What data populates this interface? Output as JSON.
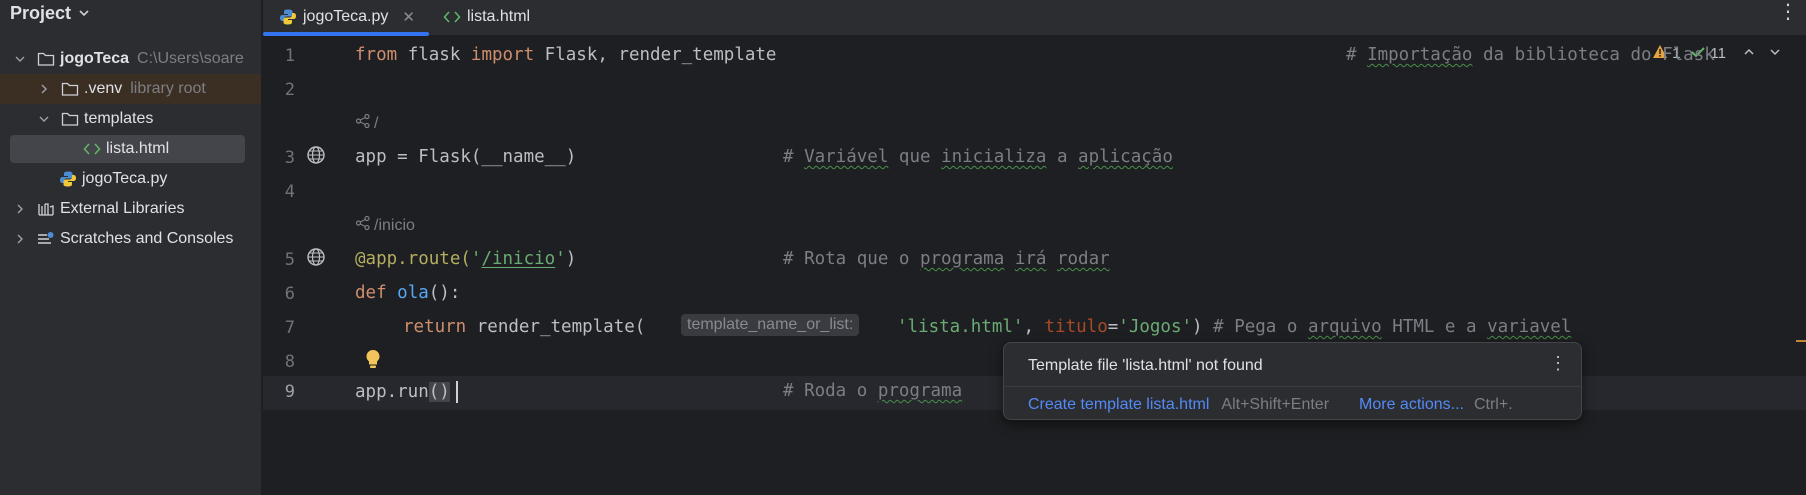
{
  "project_panel": {
    "title": "Project",
    "tree": [
      {
        "label": "jogoTeca",
        "hint": "C:\\Users\\soare"
      },
      {
        "label": ".venv",
        "hint": "library root"
      },
      {
        "label": "templates"
      },
      {
        "label": "lista.html"
      },
      {
        "label": "jogoTeca.py"
      },
      {
        "label": "External Libraries"
      },
      {
        "label": "Scratches and Consoles"
      }
    ]
  },
  "tabs": [
    {
      "label": "jogoTeca.py",
      "active": true
    },
    {
      "label": "lista.html",
      "active": false
    }
  ],
  "inspection": {
    "warnings": "1",
    "ok": "11"
  },
  "editor": {
    "line_numbers": [
      "1",
      "2",
      "3",
      "4",
      "5",
      "6",
      "7",
      "8",
      "9"
    ],
    "line1": {
      "kw1": "from",
      "mod": " flask ",
      "kw2": "import",
      "names": " Flask, render_template",
      "comment_pre": "# ",
      "comment_w1": "Importação",
      " comment_rest": "",
      "comment_rest": " da biblioteca do Flask"
    },
    "route1": "/",
    "line3": {
      "code": "app = Flask(__name__)",
      "cm_a": "# ",
      "cm_w1": "Variável",
      "cm_b": " que ",
      "cm_w2": "inicializa",
      "cm_c": " a ",
      "cm_w3": "aplicação"
    },
    "route2": "/inicio",
    "line5": {
      "dec": "@app.route(",
      "str_q": "'",
      "str_path": "/inicio",
      "str_q2": "'",
      "close": ")",
      "cm_a": "# Rota que o ",
      "cm_w1": "programa",
      "cm_b": " ",
      "cm_w2": "irá",
      "cm_c": " ",
      "cm_w3": "rodar"
    },
    "line6": {
      "kw": "def",
      "fn": "ola",
      "rest": "():"
    },
    "line7": {
      "kw": "return",
      "call": " render_template(",
      "hint": "template_name_or_list:",
      "str1": "'lista.html'",
      "comma": ", ",
      "param": "titulo",
      "eq": "=",
      "str2": "'Jogos'",
      "close": ")",
      "cm_a": " # Pega o ",
      "cm_w1": "arquivo",
      "cm_b": " HTML e a ",
      "cm_w2": "variavel"
    },
    "line9": {
      "code": "app.run",
      "parens": "()",
      "cm_a": "# Roda o ",
      "cm_w1": "programa"
    }
  },
  "popup": {
    "message": "Template file 'lista.html' not found",
    "action1": "Create template lista.html",
    "shortcut1": "Alt+Shift+Enter",
    "action2": "More actions...",
    "shortcut2": "Ctrl+."
  }
}
